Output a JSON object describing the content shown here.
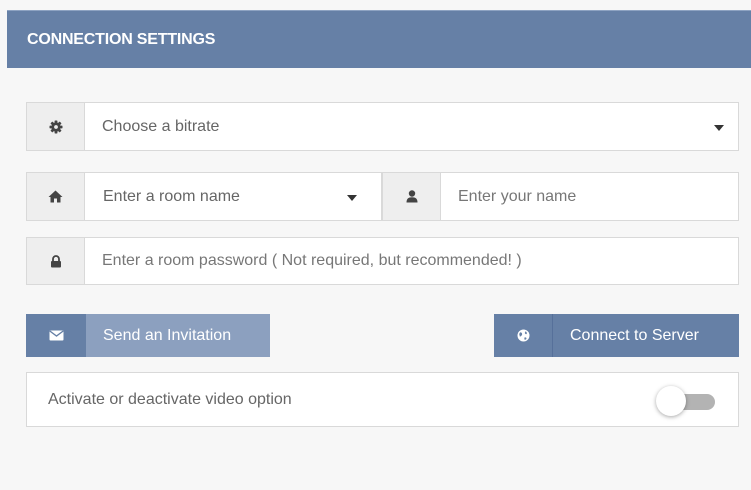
{
  "header": {
    "title": "CONNECTION SETTINGS"
  },
  "bitrate": {
    "icon": "gear-icon",
    "placeholder": "Choose a bitrate"
  },
  "room": {
    "icon": "home-icon",
    "placeholder": "Enter a room name"
  },
  "user": {
    "icon": "user-icon",
    "placeholder": "Enter your name"
  },
  "password": {
    "icon": "lock-icon",
    "placeholder": "Enter a room password ( Not required, but recommended! )"
  },
  "buttons": {
    "invite": {
      "icon": "envelope-icon",
      "label": "Send an Invitation"
    },
    "connect": {
      "icon": "globe-icon",
      "label": "Connect to Server"
    }
  },
  "video_option": {
    "label": "Activate or deactivate video option",
    "enabled": false
  },
  "colors": {
    "header": "#6680a6",
    "invite_icon_bg": "#6680a6",
    "invite_label_bg": "#8ca0bf",
    "connect_bg": "#6680a6",
    "toggle_track": "#b3b3b3"
  }
}
